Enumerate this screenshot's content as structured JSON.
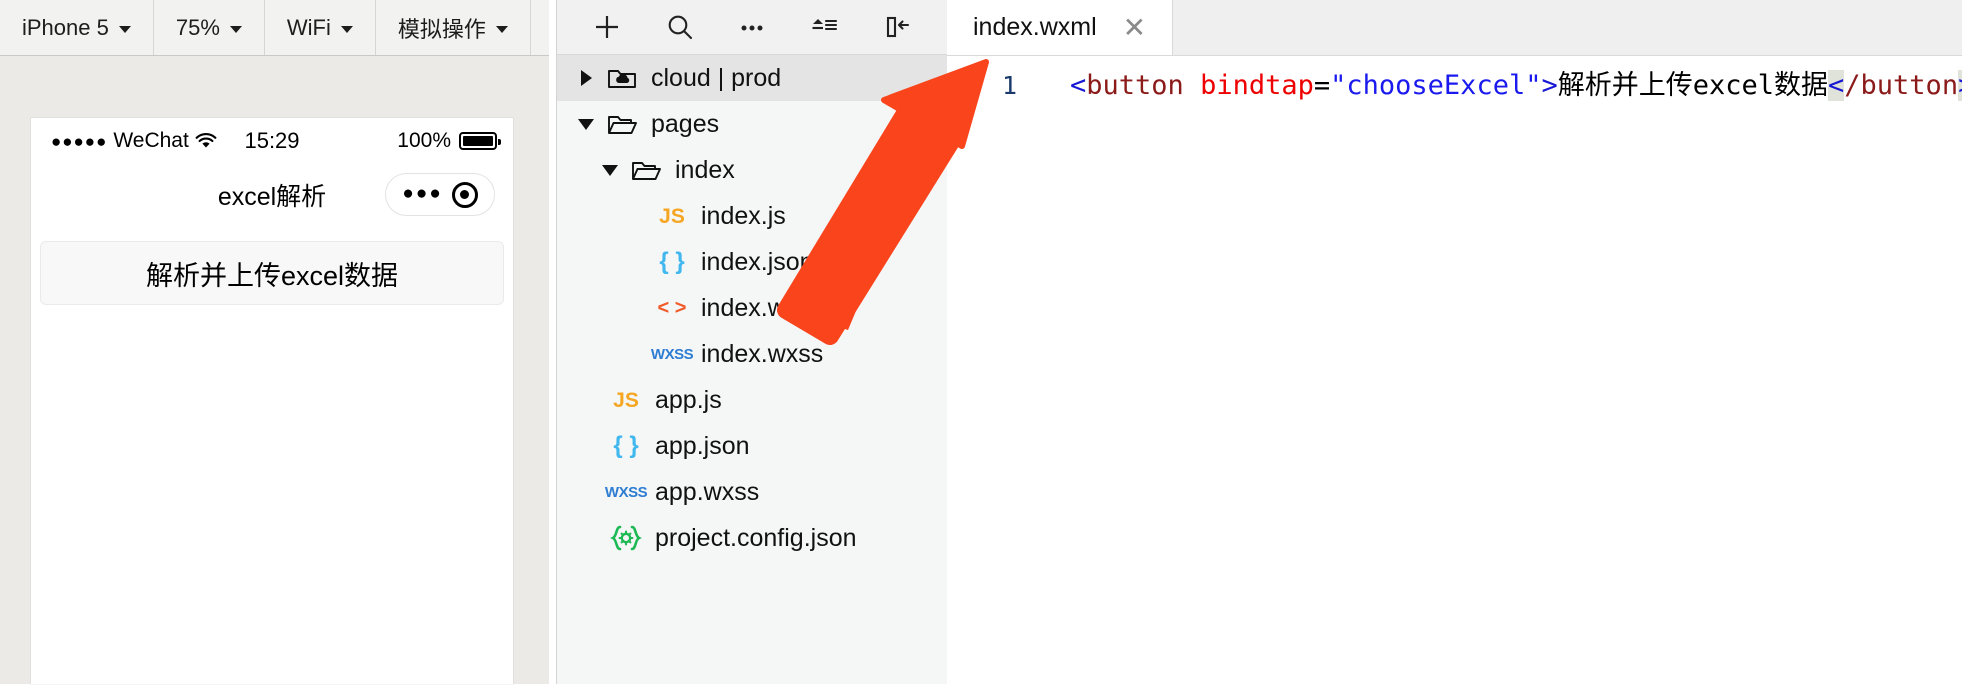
{
  "simulator": {
    "toolbar": [
      {
        "label": "iPhone 5",
        "icon": "chevron-down-icon"
      },
      {
        "label": "75%",
        "icon": "chevron-down-icon"
      },
      {
        "label": "WiFi",
        "icon": "chevron-down-icon"
      },
      {
        "label": "模拟操作",
        "icon": "chevron-down-icon"
      }
    ],
    "phone": {
      "status": {
        "signal_dots": "●●●●●",
        "carrier": "WeChat",
        "wifi_icon": "wifi-icon",
        "time": "15:29",
        "battery_percent": "100%",
        "battery_icon": "battery-full-icon"
      },
      "nav_title": "excel解析",
      "capsule": {
        "menu_icon": "ellipsis-icon",
        "target_icon": "target-icon"
      },
      "page_button_label": "解析并上传excel数据"
    }
  },
  "tree": {
    "toolbar": [
      {
        "name": "add-file-icon",
        "glyph": "plus"
      },
      {
        "name": "search-icon",
        "glyph": "search"
      },
      {
        "name": "more-options-icon",
        "glyph": "ellipsis"
      },
      {
        "name": "collapse-all-icon",
        "glyph": "collapse"
      },
      {
        "name": "toggle-panel-icon",
        "glyph": "panel"
      }
    ],
    "items": [
      {
        "label": "cloud | prod",
        "icon": "cloud-folder-icon",
        "twisty": "right",
        "indent": 0,
        "selected": true
      },
      {
        "label": "pages",
        "icon": "folder-open-icon",
        "twisty": "down",
        "indent": 0,
        "selected": false
      },
      {
        "label": "index",
        "icon": "folder-open-icon",
        "twisty": "down",
        "indent": 1,
        "selected": false
      },
      {
        "label": "index.js",
        "icon": "js-file-icon",
        "badge": "JS",
        "twisty": "none",
        "indent": 2,
        "selected": false
      },
      {
        "label": "index.json",
        "icon": "json-file-icon",
        "badge": "{ }",
        "twisty": "none",
        "indent": 2,
        "selected": false
      },
      {
        "label": "index.wxml",
        "icon": "wxml-file-icon",
        "badge": "< >",
        "twisty": "none",
        "indent": 2,
        "selected": false
      },
      {
        "label": "index.wxss",
        "icon": "wxss-file-icon",
        "badge": "WXSS",
        "twisty": "none",
        "indent": 2,
        "selected": false
      },
      {
        "label": "app.js",
        "icon": "js-file-icon",
        "badge": "JS",
        "twisty": "none",
        "indent": 1,
        "selected": false
      },
      {
        "label": "app.json",
        "icon": "json-file-icon",
        "badge": "{ }",
        "twisty": "none",
        "indent": 1,
        "selected": false
      },
      {
        "label": "app.wxss",
        "icon": "wxss-file-icon",
        "badge": "WXSS",
        "twisty": "none",
        "indent": 1,
        "selected": false
      },
      {
        "label": "project.config.json",
        "icon": "config-file-icon",
        "badge": "{✿}",
        "twisty": "none",
        "indent": 1,
        "selected": false
      }
    ]
  },
  "editor": {
    "tab": {
      "label": "index.wxml",
      "close_icon": "close-icon"
    },
    "line_number": "1",
    "code": {
      "open_bracket": "<",
      "tag_name": "button",
      "space": " ",
      "attr_name": "bindtap",
      "equals": "=",
      "attr_value": "\"chooseExcel\"",
      "close_bracket": ">",
      "inner_text": "解析并上传excel数据",
      "close_tag_open": "<",
      "close_tag_body": "/button",
      "close_tag_end": ">"
    }
  },
  "annotation": {
    "arrow_color": "#f9441c",
    "arrow_name": "red-arrow-pointing-to-editor"
  },
  "colors": {
    "sim_bg": "#ebeae6",
    "tree_bg": "#f5f6f6",
    "tree_selected": "#e4e4e4",
    "editor_bg": "#ffffff",
    "accent_red": "#f9441c"
  }
}
